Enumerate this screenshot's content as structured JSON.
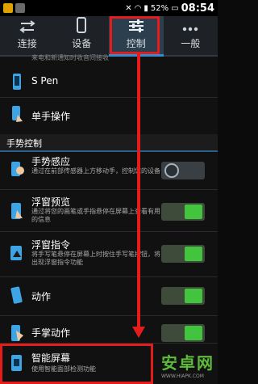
{
  "status": {
    "battery": "52%",
    "time": "08:54"
  },
  "tabs": [
    {
      "label": "连接"
    },
    {
      "label": "设备"
    },
    {
      "label": "控制"
    },
    {
      "label": "一般"
    }
  ],
  "top_fragment": "来电和新通知时收音间接收",
  "rows": {
    "spen": {
      "label": "S Pen"
    },
    "onehand": {
      "label": "单手操作"
    }
  },
  "section": "手势控制",
  "items": [
    {
      "label": "手势感应",
      "desc": "通过在前部传感器上方移动手，控制您的设备",
      "state": "off"
    },
    {
      "label": "浮窗预览",
      "desc": "通过将您的画笔或手指悬停在屏幕上查看有用的信息",
      "state": "on"
    },
    {
      "label": "浮窗指令",
      "desc": "将手写笔悬停在屏幕上时按住手写笔按钮，将出现浮窗指令功能",
      "state": "on"
    },
    {
      "label": "动作",
      "desc": "",
      "state": "on"
    },
    {
      "label": "手掌动作",
      "desc": "",
      "state": "on"
    },
    {
      "label": "智能屏幕",
      "desc": "使用智能面部检测功能",
      "state": ""
    }
  ],
  "watermark": {
    "text": "安卓网",
    "url": "WWW.HIAPK.COM"
  },
  "colors": {
    "accent": "#2b8fd6",
    "toggle_on": "#43c43f",
    "annotation": "#e41c1c"
  }
}
